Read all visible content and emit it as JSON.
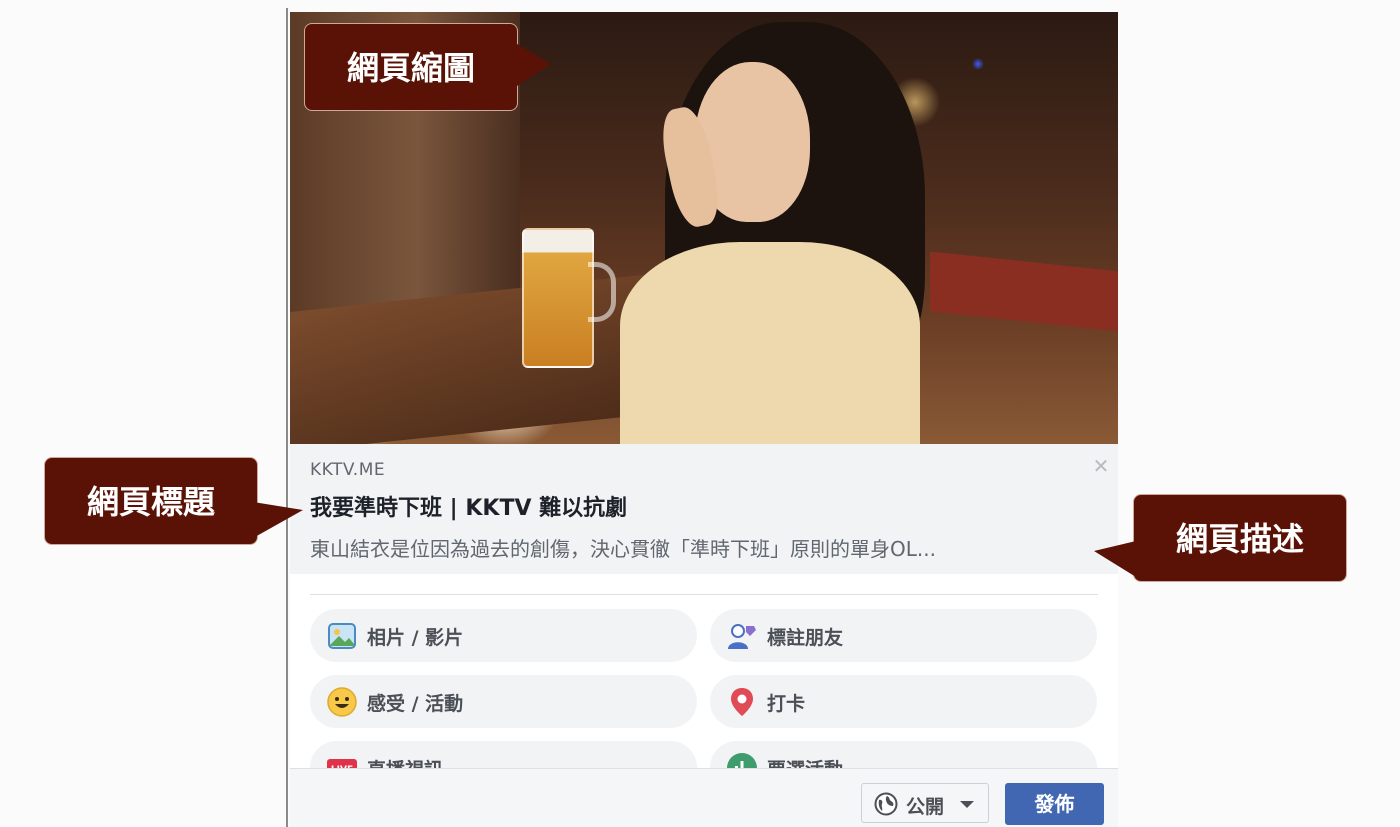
{
  "preview": {
    "domain": "KKTV.ME",
    "title": "我要準時下班 | KKTV 難以抗劇",
    "description": "東山結衣是位因為過去的創傷，決心貫徹「準時下班」原則的單身OL...",
    "close_symbol": "✕"
  },
  "options": {
    "photo": "相片 / 影片",
    "tag": "標註朋友",
    "feeling": "感受 / 活動",
    "checkin": "打卡",
    "live": "直播視訊",
    "poll": "票選活動"
  },
  "footer": {
    "privacy": "公開",
    "post": "發佈"
  },
  "callouts": {
    "thumbnail": "網頁縮圖",
    "title": "網頁標題",
    "description": "網頁描述"
  },
  "colors": {
    "callout_bg": "#5b1206",
    "post_button": "#4267b2",
    "option_bg": "#f2f3f5"
  },
  "icons": {
    "photo": "photo-icon",
    "tag": "tag-friend-icon",
    "feeling": "smiley-icon",
    "checkin": "location-pin-icon",
    "live": "live-icon",
    "poll": "poll-icon",
    "privacy": "globe-icon",
    "caret": "caret-down-icon"
  }
}
